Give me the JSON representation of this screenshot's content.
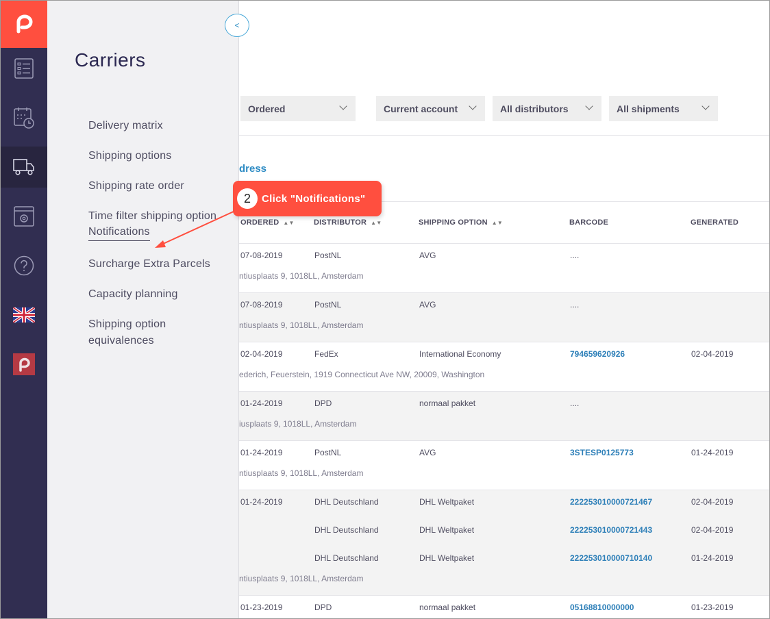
{
  "colors": {
    "brand": "#ff4f3f",
    "rail": "#312e51",
    "link": "#2d8bc4"
  },
  "rail": {
    "logo": "parcelpro-logo-icon",
    "items": [
      {
        "icon": "list-icon"
      },
      {
        "icon": "calendar-clock-icon"
      },
      {
        "icon": "truck-icon",
        "active": true
      },
      {
        "icon": "settings-window-icon"
      },
      {
        "icon": "help-icon"
      },
      {
        "icon": "uk-flag-icon"
      },
      {
        "icon": "brand-small-icon"
      }
    ]
  },
  "submenu": {
    "title": "Carriers",
    "collapse_label": "<",
    "items": [
      "Delivery matrix",
      "Shipping options",
      "Shipping rate order",
      "Time filter shipping option",
      "Notifications",
      "Surcharge Extra Parcels",
      "Capacity planning",
      "Shipping option equivalences"
    ]
  },
  "filters": [
    "Ordered",
    "Current account",
    "All distributors",
    "All shipments"
  ],
  "address_link": "dress",
  "callout": {
    "step": "2",
    "text": "Click \"Notifications\""
  },
  "table": {
    "headers": [
      "ORDERED",
      "DISTRIBUTOR",
      "SHIPPING OPTION",
      "BARCODE",
      "GENERATED"
    ],
    "rows": [
      {
        "ordered": "07-08-2019",
        "lines": [
          {
            "distributor": "PostNL",
            "option": "AVG",
            "barcode": "....",
            "generated": ""
          }
        ],
        "address": "ntiusplaats 9, 1018LL, Amsterdam"
      },
      {
        "ordered": "07-08-2019",
        "lines": [
          {
            "distributor": "PostNL",
            "option": "AVG",
            "barcode": "....",
            "generated": ""
          }
        ],
        "address": "ntiusplaats 9, 1018LL, Amsterdam"
      },
      {
        "ordered": "02-04-2019",
        "lines": [
          {
            "distributor": "FedEx",
            "option": "International Economy",
            "barcode": "794659620926",
            "generated": "02-04-2019"
          }
        ],
        "address": "ederich, Feuerstein, 1919 Connecticut Ave NW, 20009, Washington"
      },
      {
        "ordered": "01-24-2019",
        "lines": [
          {
            "distributor": "DPD",
            "option": "normaal pakket",
            "barcode": "....",
            "generated": ""
          }
        ],
        "address": "iusplaats 9, 1018LL, Amsterdam"
      },
      {
        "ordered": "01-24-2019",
        "lines": [
          {
            "distributor": "PostNL",
            "option": "AVG",
            "barcode": "3STESP0125773",
            "generated": "01-24-2019"
          }
        ],
        "address": "ntiusplaats 9, 1018LL, Amsterdam"
      },
      {
        "ordered": "01-24-2019",
        "lines": [
          {
            "distributor": "DHL Deutschland",
            "option": "DHL Weltpaket",
            "barcode": "222253010000721467",
            "generated": "02-04-2019"
          },
          {
            "distributor": "DHL Deutschland",
            "option": "DHL Weltpaket",
            "barcode": "222253010000721443",
            "generated": "02-04-2019"
          },
          {
            "distributor": "DHL Deutschland",
            "option": "DHL Weltpaket",
            "barcode": "222253010000710140",
            "generated": "01-24-2019"
          }
        ],
        "address": "ntiusplaats 9, 1018LL, Amsterdam"
      },
      {
        "ordered": "01-23-2019",
        "lines": [
          {
            "distributor": "DPD",
            "option": "normaal pakket",
            "barcode": "05168810000000",
            "generated": "01-23-2019"
          }
        ],
        "address": ""
      }
    ]
  }
}
